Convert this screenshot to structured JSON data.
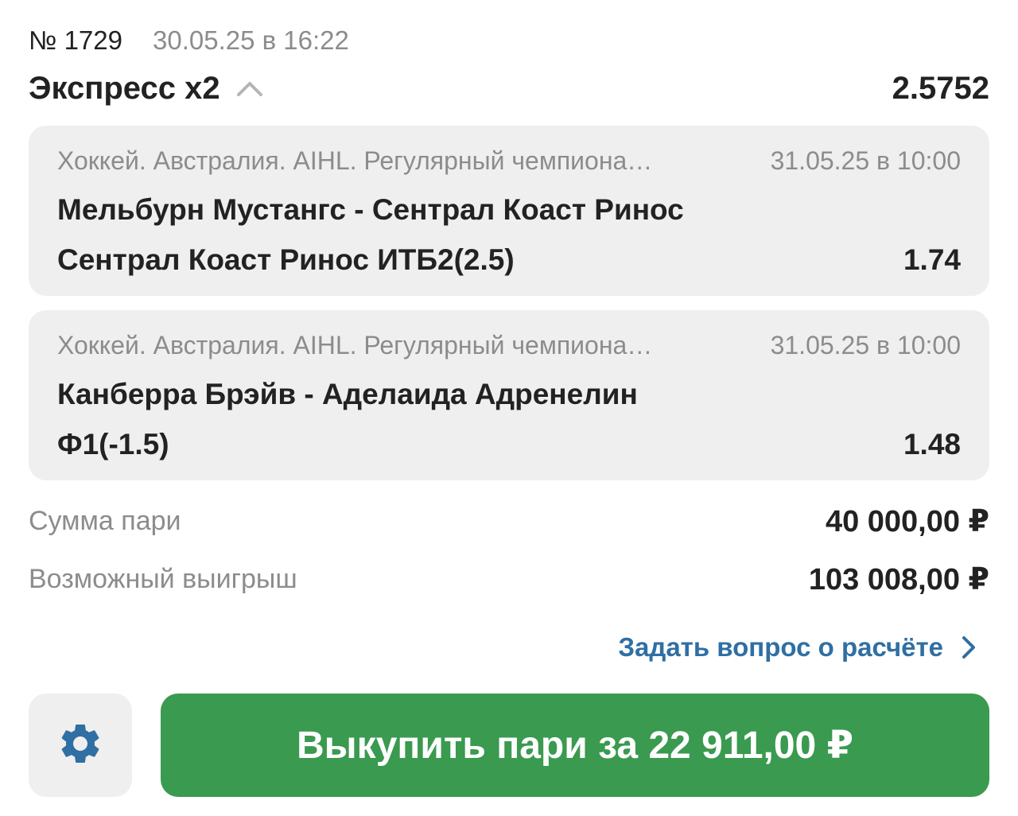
{
  "bet": {
    "number": "№ 1729",
    "datetime": "30.05.25 в 16:22",
    "type": "Экспресс х2",
    "total_odds": "2.5752"
  },
  "events": [
    {
      "league": "Хоккей. Австралия. AIHL. Регулярный чемпиона…",
      "datetime": "31.05.25 в 10:00",
      "teams": "Мельбурн Мустангс - Сентрал Коаст Ринос",
      "outcome": "Сентрал Коаст Ринос ИТБ2(2.5)",
      "odds": "1.74"
    },
    {
      "league": "Хоккей. Австралия. AIHL. Регулярный чемпиона…",
      "datetime": "31.05.25 в 10:00",
      "teams": "Канберра Брэйв - Аделаида Адренелин",
      "outcome": "Ф1(-1.5)",
      "odds": "1.48"
    }
  ],
  "summary": {
    "stake_label": "Сумма пари",
    "stake_value": "40 000,00 ₽",
    "win_label": "Возможный выигрыш",
    "win_value": "103 008,00 ₽"
  },
  "question_link": {
    "label": "Задать вопрос о расчёте",
    "icon": "chevron-right-icon"
  },
  "settings": {
    "icon": "gear-icon"
  },
  "buyout": {
    "label": "Выкупить пари за 22 911,00 ₽"
  },
  "colors": {
    "accent_green": "#3a9a4f",
    "link_blue": "#2f6fa3",
    "card_bg": "#efefef",
    "muted_text": "#8c8c8c"
  }
}
